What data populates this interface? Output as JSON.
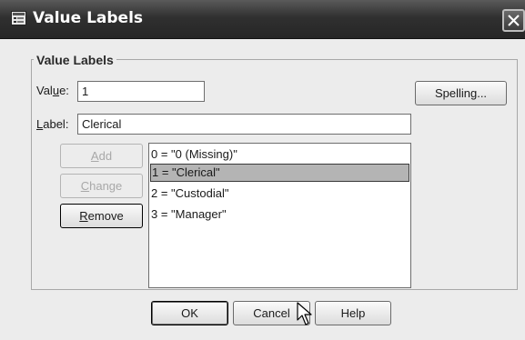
{
  "window": {
    "title": "Value Labels"
  },
  "group": {
    "legend": "Value Labels"
  },
  "value_field": {
    "label_pre": "Val",
    "label_ul": "u",
    "label_post": "e:",
    "value": "1"
  },
  "label_field": {
    "label_ul": "L",
    "label_post": "abel:",
    "value": "Clerical"
  },
  "buttons": {
    "spelling": "Spelling...",
    "add": {
      "ul": "A",
      "rest": "dd"
    },
    "change": {
      "ul": "C",
      "rest": "hange"
    },
    "remove": {
      "ul": "R",
      "rest": "emove"
    },
    "ok": "OK",
    "cancel": "Cancel",
    "help": "Help"
  },
  "list": {
    "items": [
      "0 = \"0 (Missing)\"",
      "1 = \"Clerical\"",
      "2 = \"Custodial\"",
      "3 = \"Manager\""
    ],
    "selected_index": 1
  },
  "icons": {
    "title": "dialog-app-icon",
    "close": "close-icon",
    "cursor": "mouse-pointer-icon"
  }
}
